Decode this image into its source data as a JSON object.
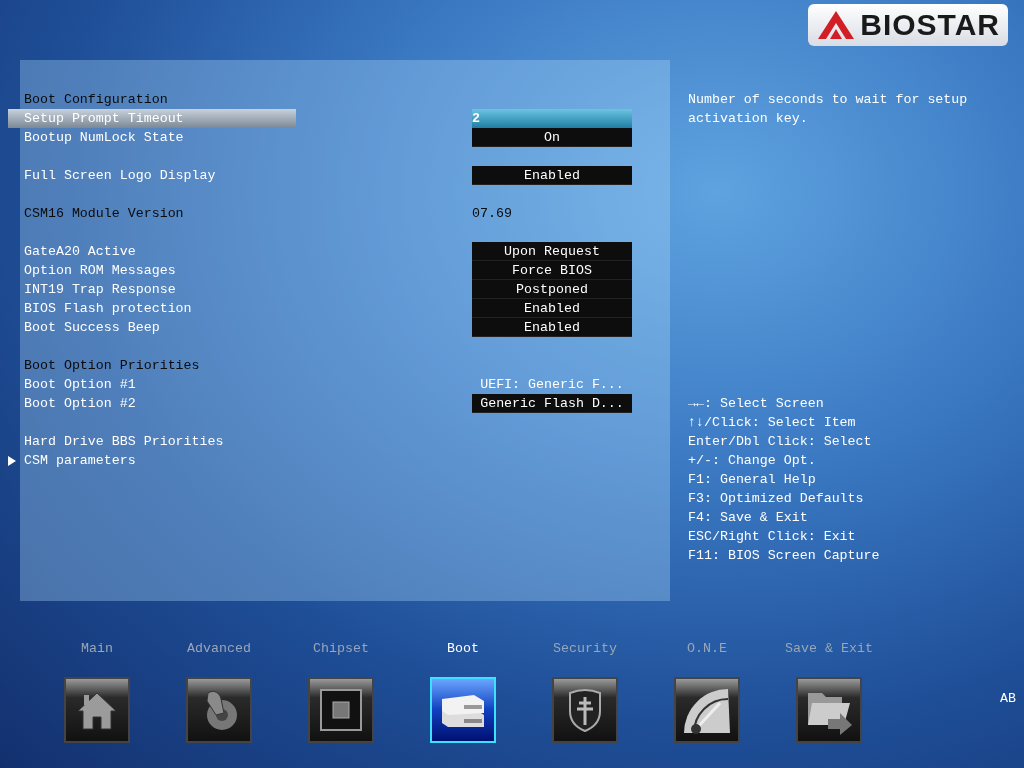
{
  "brand": {
    "name": "BIOSTAR"
  },
  "groups": [
    {
      "items": [
        {
          "kind": "heading",
          "label": "Boot Configuration",
          "selected": false
        },
        {
          "kind": "setting",
          "label": "Setup Prompt Timeout",
          "value": {
            "text": "2",
            "kind": "field"
          },
          "selected": true
        },
        {
          "kind": "setting",
          "label": "Bootup NumLock State",
          "value": {
            "text": "On",
            "kind": "box"
          },
          "selected": false
        }
      ]
    },
    {
      "items": [
        {
          "kind": "setting",
          "label": "Full Screen Logo Display",
          "value": {
            "text": "Enabled",
            "kind": "box"
          },
          "selected": false
        }
      ]
    },
    {
      "items": [
        {
          "kind": "info",
          "label": "CSM16 Module Version",
          "value": {
            "text": "07.69",
            "kind": "info"
          },
          "selected": false
        }
      ]
    },
    {
      "items": [
        {
          "kind": "setting",
          "label": "GateA20 Active",
          "value": {
            "text": "Upon Request",
            "kind": "box"
          },
          "selected": false
        },
        {
          "kind": "setting",
          "label": "Option ROM Messages",
          "value": {
            "text": "Force BIOS",
            "kind": "box"
          },
          "selected": false
        },
        {
          "kind": "setting",
          "label": "INT19 Trap Response",
          "value": {
            "text": "Postponed",
            "kind": "box"
          },
          "selected": false
        },
        {
          "kind": "setting",
          "label": "BIOS Flash protection",
          "value": {
            "text": "Enabled",
            "kind": "box"
          },
          "selected": false
        },
        {
          "kind": "setting",
          "label": "Boot Success Beep",
          "value": {
            "text": "Enabled",
            "kind": "box"
          },
          "selected": false
        }
      ]
    },
    {
      "items": [
        {
          "kind": "heading",
          "label": "Boot Option Priorities",
          "selected": false
        },
        {
          "kind": "setting",
          "label": "Boot Option #1",
          "value": {
            "text": "UEFI: Generic F...",
            "kind": "plain"
          },
          "selected": false
        },
        {
          "kind": "setting",
          "label": "Boot Option #2",
          "value": {
            "text": "Generic Flash D...",
            "kind": "box"
          },
          "selected": false
        }
      ]
    },
    {
      "items": [
        {
          "kind": "setting",
          "label": "Hard Drive BBS Priorities",
          "selected": false
        },
        {
          "kind": "submenu",
          "label": "CSM parameters",
          "selected": false
        }
      ]
    }
  ],
  "help": {
    "description": "Number of seconds to wait for setup activation key.",
    "keys": [
      "→←: Select Screen",
      "↑↓/Click: Select Item",
      "Enter/Dbl Click: Select",
      "+/-: Change Opt.",
      "F1: General Help",
      "F3: Optimized Defaults",
      "F4: Save & Exit",
      "ESC/Right Click: Exit",
      "F11: BIOS Screen Capture"
    ]
  },
  "tabs": [
    {
      "label": "Main",
      "selected": false
    },
    {
      "label": "Advanced",
      "selected": false
    },
    {
      "label": "Chipset",
      "selected": false
    },
    {
      "label": "Boot",
      "selected": true
    },
    {
      "label": "Security",
      "selected": false
    },
    {
      "label": "O.N.E",
      "selected": false
    },
    {
      "label": "Save & Exit",
      "selected": false
    }
  ],
  "status": "AB"
}
